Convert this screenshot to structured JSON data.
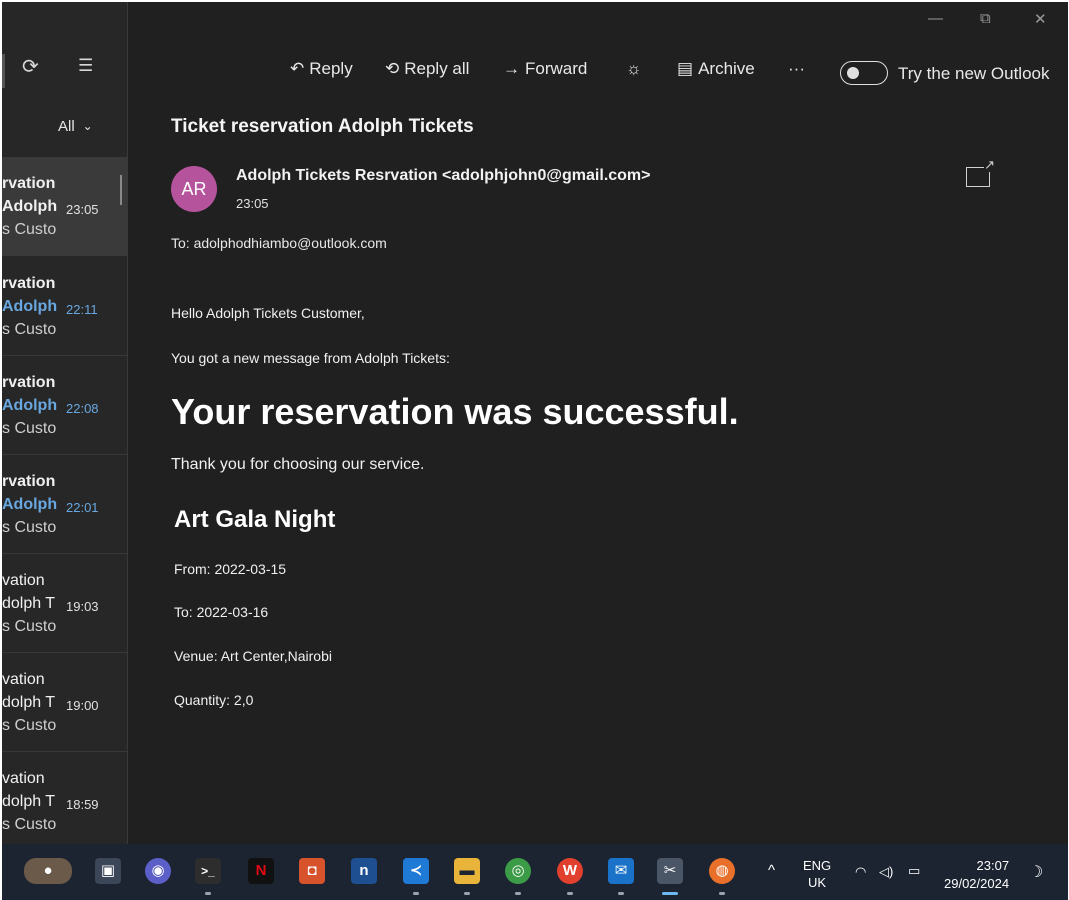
{
  "window": {
    "minimize_glyph": "—",
    "restore_glyph": "⧉",
    "close_glyph": "✕"
  },
  "list_toolbar": {
    "sync_glyph": "⟳",
    "select_glyph": "☰",
    "filter_label": "All",
    "filter_chevron": "⌄"
  },
  "messages": [
    {
      "line1": "rvation",
      "line2": "Adolph",
      "line3": "s Custo",
      "time": "23:05"
    },
    {
      "line1": "rvation",
      "line2": "Adolph",
      "line3": "s Custo",
      "time": "22:11"
    },
    {
      "line1": "rvation",
      "line2": "Adolph",
      "line3": "s Custo",
      "time": "22:08"
    },
    {
      "line1": "rvation",
      "line2": "Adolph",
      "line3": "s Custo",
      "time": "22:01"
    },
    {
      "line1": "vation",
      "line2": "dolph T",
      "line3": "s Custo",
      "time": "19:03"
    },
    {
      "line1": "vation",
      "line2": "dolph T",
      "line3": "s Custo",
      "time": "19:00"
    },
    {
      "line1": "vation",
      "line2": "dolph T",
      "line3": "s Custo",
      "time": "18:59"
    }
  ],
  "reading_toolbar": {
    "reply": "Reply",
    "reply_all": "Reply all",
    "forward": "Forward",
    "archive": "Archive",
    "more": "···",
    "try_new_outlook": "Try the new Outlook"
  },
  "email": {
    "subject": "Ticket reservation Adolph Tickets",
    "avatar_initials": "AR",
    "avatar_color": "#b5549c",
    "sender": "Adolph Tickets Resrvation <adolphjohn0@gmail.com>",
    "time": "23:05",
    "to": "To: adolphodhiambo@outlook.com",
    "greeting": "Hello Adolph Tickets Customer,",
    "intro": "You got a new message from Adolph Tickets:",
    "headline": "Your reservation was successful.",
    "thanks": "Thank you for choosing our service.",
    "event_name": "Art Gala Night",
    "from": "From: 2022-03-15",
    "to_date": "To: 2022-03-16",
    "venue": "Venue: Art Center,Nairobi",
    "quantity": "Quantity: 2,0"
  },
  "taskbar": {
    "apps": [
      {
        "name": "explorer-widget",
        "glyph": "●",
        "color": "#6b5a4a"
      },
      {
        "name": "task-view",
        "glyph": "▣",
        "color": "#3b4658"
      },
      {
        "name": "teams-chat",
        "glyph": "◉",
        "color": "#5b5fc7"
      },
      {
        "name": "terminal",
        "glyph": ">_",
        "color": "#2d2d2d"
      },
      {
        "name": "netflix",
        "glyph": "N",
        "color": "#111111"
      },
      {
        "name": "office",
        "glyph": "◘",
        "color": "#d6532c"
      },
      {
        "name": "notion",
        "glyph": "n",
        "color": "#1d4f91"
      },
      {
        "name": "vscode",
        "glyph": "≺",
        "color": "#1e7ad4"
      },
      {
        "name": "file-explorer",
        "glyph": "▬",
        "color": "#e8b43a"
      },
      {
        "name": "chrome",
        "glyph": "◎",
        "color": "#3c9b46"
      },
      {
        "name": "wps-office",
        "glyph": "W",
        "color": "#e1402e"
      },
      {
        "name": "mail",
        "glyph": "✉",
        "color": "#1a73c9"
      },
      {
        "name": "snipping-tool",
        "glyph": "✂",
        "color": "#4a5566"
      },
      {
        "name": "firefox",
        "glyph": "◍",
        "color": "#e8702a"
      }
    ],
    "tray_chevron": "^",
    "language_line1": "ENG",
    "language_line2": "UK",
    "wifi_glyph": "◠",
    "volume_glyph": "◁)",
    "battery_glyph": "▭",
    "clock_time": "23:07",
    "clock_date": "29/02/2024",
    "notifications_glyph": "☽"
  }
}
